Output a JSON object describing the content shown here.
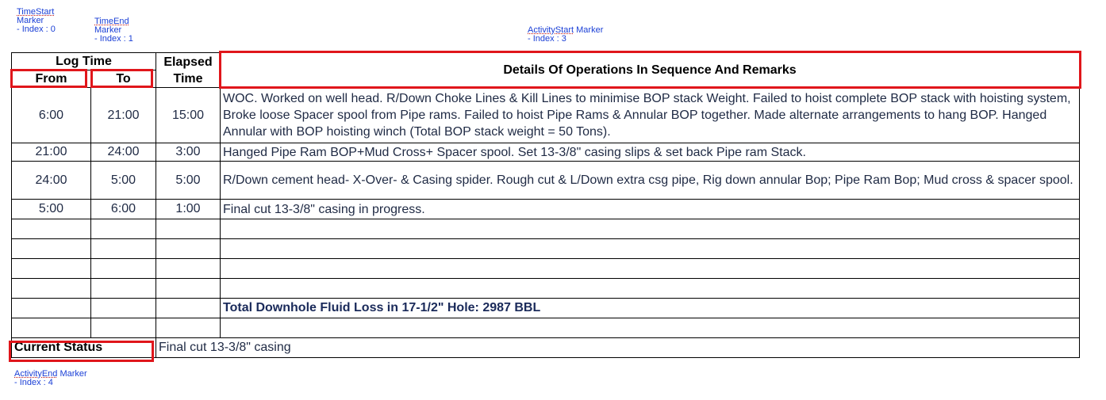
{
  "markers": {
    "time_start": {
      "line1": "TimeStart",
      "line2": "Marker",
      "line3": "- Index : 0"
    },
    "time_end": {
      "line1": "TimeEnd",
      "line2": "Marker",
      "line3": "- Index : 1"
    },
    "activity_start": {
      "line1": "ActivityStart",
      "line1b": " Marker",
      "line2": "- Index : 3"
    },
    "activity_end": {
      "line1": "ActivityEnd",
      "line1b": " Marker",
      "line2": "- Index : 4"
    }
  },
  "header": {
    "log_time": "Log Time",
    "from": "From",
    "to": "To",
    "elapsed_1": "Elapsed",
    "elapsed_2": "Time",
    "details": "Details Of Operations In Sequence And Remarks"
  },
  "rows": [
    {
      "from": "6:00",
      "to": "21:00",
      "elapsed": "15:00",
      "remarks": "WOC. Worked on well head. R/Down Choke Lines & Kill Lines to minimise BOP stack Weight. Failed to hoist complete BOP stack with hoisting system, Broke loose Spacer spool from  Pipe rams. Failed to hoist Pipe Rams & Annular BOP together. Made alternate arrangements  to hang BOP. Hanged Annular with BOP hoisting winch (Total BOP stack weight = 50 Tons)."
    },
    {
      "from": "21:00",
      "to": "24:00",
      "elapsed": "3:00",
      "remarks": "Hanged Pipe Ram BOP+Mud Cross+ Spacer spool. Set 13-3/8\" casing slips & set back Pipe ram Stack."
    },
    {
      "from": "24:00",
      "to": "5:00",
      "elapsed": "5:00",
      "remarks": "R/Down cement head- X-Over- & Casing spider. Rough cut & L/Down extra csg pipe, Rig down annular Bop; Pipe Ram Bop; Mud cross & spacer spool."
    },
    {
      "from": "5:00",
      "to": "6:00",
      "elapsed": "1:00",
      "remarks": "Final cut 13-3/8\" casing in progress."
    }
  ],
  "fluid_loss": "Total Downhole Fluid Loss in 17-1/2\" Hole: 2987 BBL",
  "status": {
    "label": "Current Status",
    "value": "Final cut 13-3/8\" casing"
  }
}
